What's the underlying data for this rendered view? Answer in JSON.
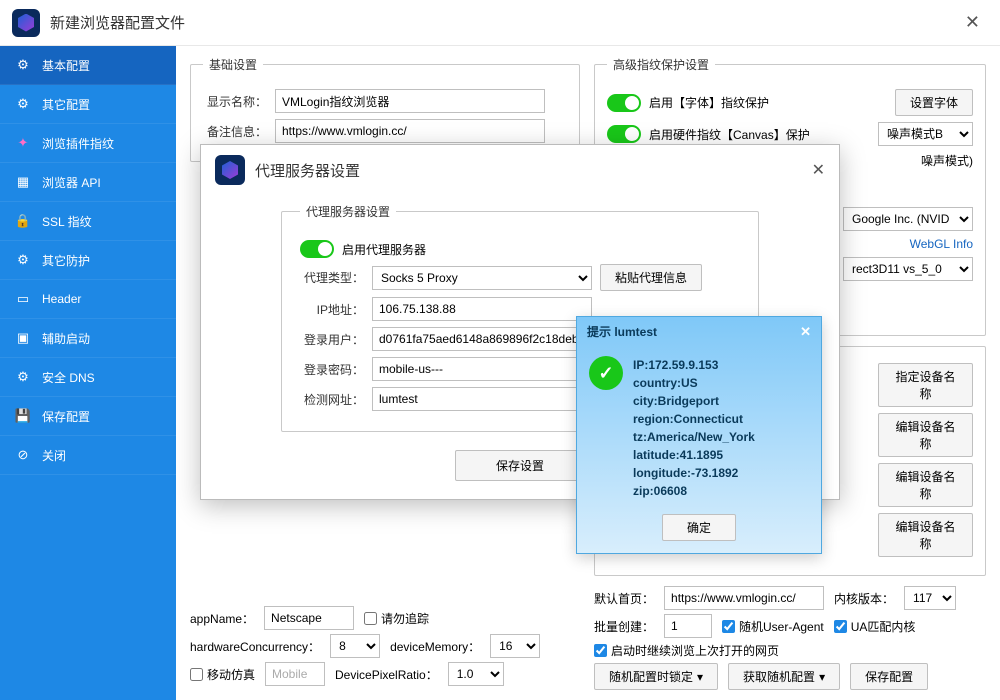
{
  "window": {
    "title": "新建浏览器配置文件"
  },
  "sidebar": [
    {
      "icon": "gear",
      "label": "基本配置",
      "active": true
    },
    {
      "icon": "gear",
      "label": "其它配置"
    },
    {
      "icon": "plugin",
      "label": "浏览插件指纹",
      "pink": true
    },
    {
      "icon": "api",
      "label": "浏览器 API"
    },
    {
      "icon": "lock",
      "label": "SSL 指纹"
    },
    {
      "icon": "shield",
      "label": "其它防护"
    },
    {
      "icon": "header",
      "label": "Header"
    },
    {
      "icon": "cmd",
      "label": "辅助启动"
    },
    {
      "icon": "dns",
      "label": "安全 DNS"
    },
    {
      "icon": "save",
      "label": "保存配置"
    },
    {
      "icon": "close",
      "label": "关闭"
    }
  ],
  "basic": {
    "legend": "基础设置",
    "name_lbl": "显示名称：",
    "name_val": "VMLogin指纹浏览器",
    "remark_lbl": "备注信息：",
    "remark_val": "https://www.vmlogin.cc/"
  },
  "adv": {
    "legend": "高级指纹保护设置",
    "font_lbl": "启用【字体】指纹保护",
    "font_btn": "设置字体",
    "canvas_lbl": "启用硬件指纹【Canvas】保护",
    "canvas_mode": "噪声模式B",
    "noise_mode": "噪声模式)",
    "vendor": "Google Inc. (NVID",
    "webgl_info": "WebGL Info",
    "d3d": "rect3D11 vs_5_0"
  },
  "device": {
    "legend_btn": "指定设备名称",
    "edit_btn": "编辑设备名称"
  },
  "nav": {
    "appname_lbl": "appName：",
    "appname_val": "Netscape",
    "dnt": "请勿追踪",
    "hw_lbl": "hardwareConcurrency：",
    "hw_val": "8",
    "mem_lbl": "deviceMemory：",
    "mem_val": "16",
    "mobile_chk": "移动仿真",
    "mobile_val": "Mobile",
    "dpr_lbl": "DevicePixelRatio：",
    "dpr_val": "1.0"
  },
  "right_bottom": {
    "home_lbl": "默认首页：",
    "home_val": "https://www.vmlogin.cc/",
    "kernel_lbl": "内核版本：",
    "kernel_val": "117",
    "batch_lbl": "批量创建：",
    "batch_val": "1",
    "rand_ua": "随机User-Agent",
    "ua_kernel": "UA匹配内核",
    "resume": "启动时继续浏览上次打开的网页",
    "btn1": "随机配置时锁定",
    "btn2": "获取随机配置",
    "btn3": "保存配置"
  },
  "proxy_modal": {
    "title": "代理服务器设置",
    "legend": "代理服务器设置",
    "enable": "启用代理服务器",
    "type_lbl": "代理类型：",
    "type_val": "Socks 5 Proxy",
    "paste_btn": "粘贴代理信息",
    "ip_lbl": "IP地址：",
    "ip_val": "106.75.138.88",
    "user_lbl": "登录用户：",
    "user_val": "d0761fa75aed6148a869896f2c18debf-a",
    "pass_lbl": "登录密码：",
    "pass_val": "mobile-us---",
    "test_lbl": "检测网址：",
    "test_val": "lumtest",
    "save_btn": "保存设置"
  },
  "popup": {
    "title": "提示 lumtest",
    "lines": [
      "IP:172.59.9.153",
      "country:US",
      "city:Bridgeport",
      "region:Connecticut",
      "tz:America/New_York",
      "latitude:41.1895",
      "longitude:-73.1892",
      "zip:06608"
    ],
    "ok": "确定"
  }
}
